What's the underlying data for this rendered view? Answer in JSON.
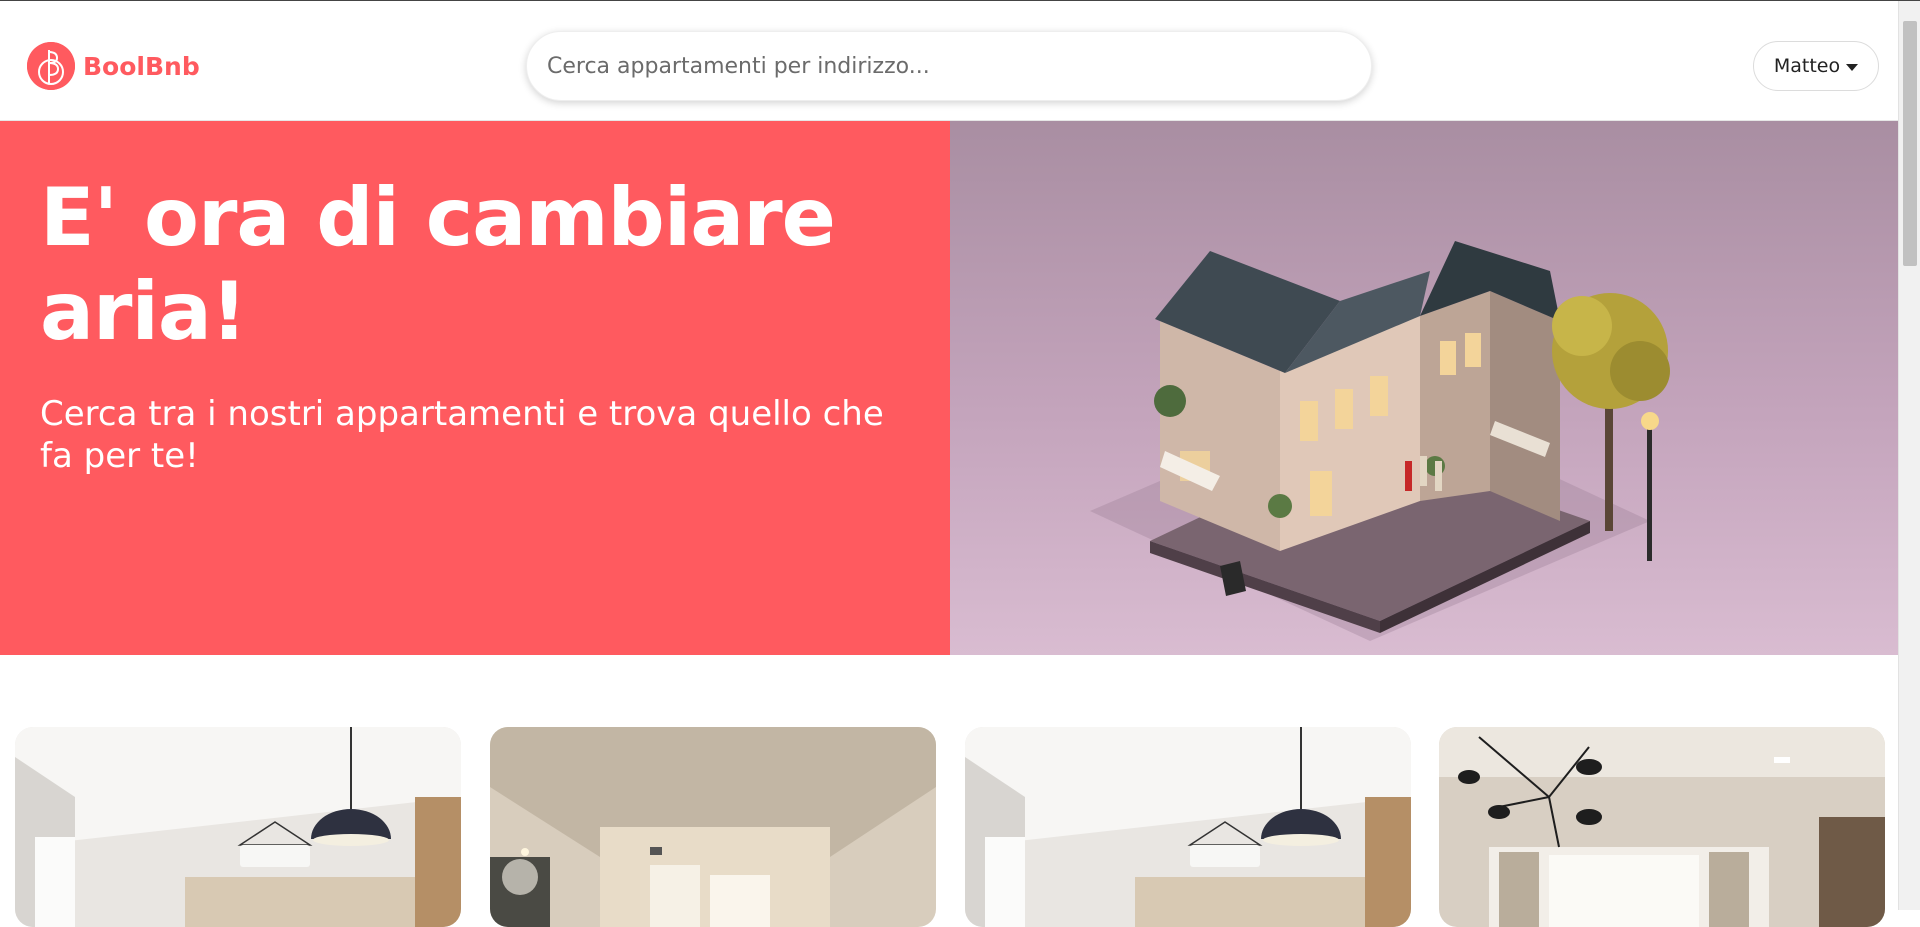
{
  "header": {
    "brand": "BoolBnb",
    "search_placeholder": "Cerca appartamenti per indirizzo...",
    "user_name": "Matteo"
  },
  "hero": {
    "title": "E' ora di cambiare aria!",
    "subtitle": "Cerca tra i nostri appartamenti e trova quello che fa per te!"
  },
  "colors": {
    "accent": "#ff5a5f"
  },
  "icons": {
    "logo": "boolbnb-logo-icon",
    "user_menu": "caret-down-icon"
  },
  "apartments": [
    {
      "image": "apartment-photo-1"
    },
    {
      "image": "apartment-photo-2"
    },
    {
      "image": "apartment-photo-3"
    },
    {
      "image": "apartment-photo-4"
    }
  ]
}
